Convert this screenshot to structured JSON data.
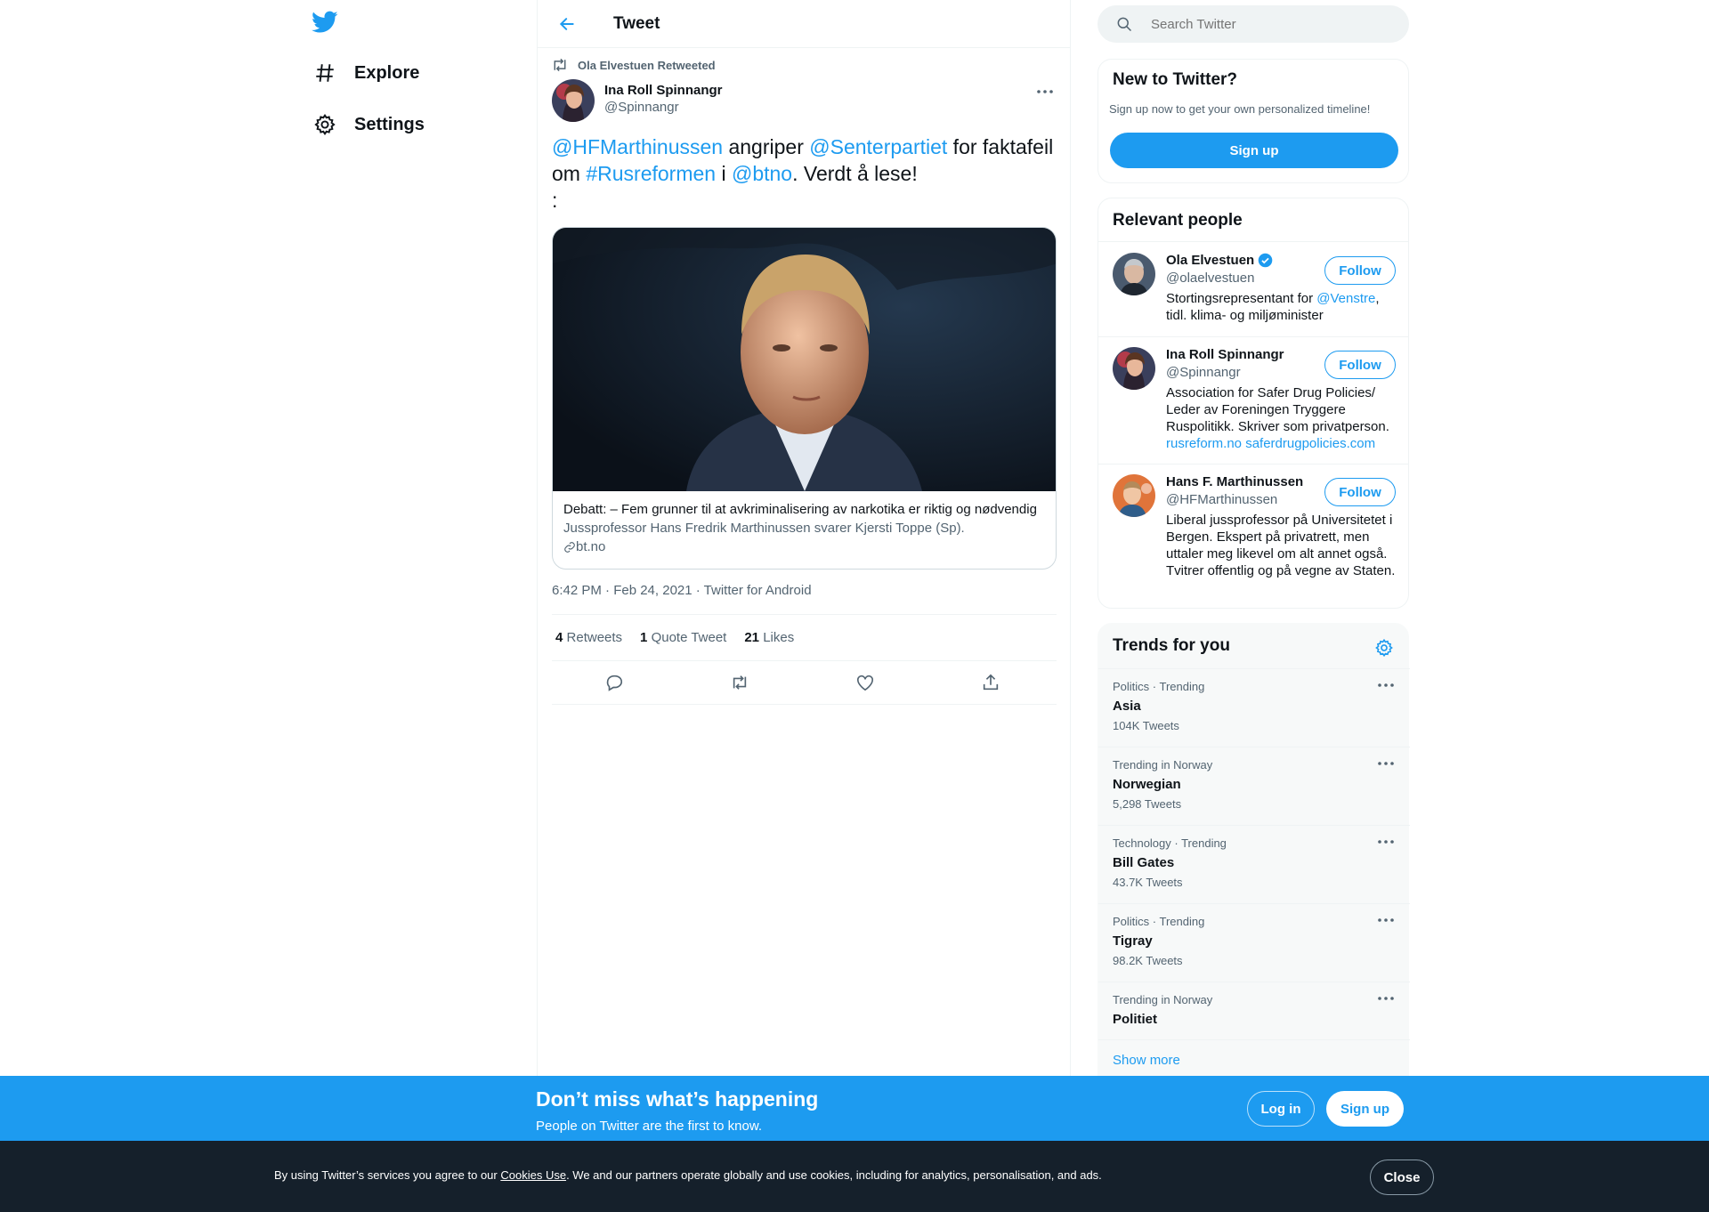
{
  "nav": {
    "logo": "twitter-bird-icon",
    "items": [
      {
        "label": "Explore",
        "icon": "hashtag-icon"
      },
      {
        "label": "Settings",
        "icon": "gear-icon"
      }
    ]
  },
  "header": {
    "title": "Tweet"
  },
  "tweet": {
    "retweeted_by": "Ola Elvestuen Retweeted",
    "author_name": "Ina Roll Spinnangr",
    "author_handle": "@Spinnangr",
    "text": {
      "m1": "@HFMarthinussen",
      "t1": " angriper ",
      "m2": "@Senterpartiet",
      "t2": " for faktafeil om ",
      "h1": "#Rusreformen",
      "t3": " i ",
      "m3": "@btno",
      "t4": ". Verdt å lese!",
      "t5": ":"
    },
    "card": {
      "title": "Debatt: – Fem grunner til at avkriminalisering av narkotika er riktig og nødvendig",
      "description": "Jussprofessor Hans Fredrik Marthinussen svarer Kjersti Toppe (Sp).",
      "domain": "bt.no"
    },
    "timestamp": "6:42 PM · Feb 24, 2021 · Twitter for Android",
    "stats": {
      "retweets": "4",
      "retweets_label": "Retweets",
      "quotes": "1",
      "quotes_label": "Quote Tweet",
      "likes": "21",
      "likes_label": "Likes"
    }
  },
  "search": {
    "placeholder": "Search Twitter"
  },
  "new_to_twitter": {
    "title": "New to Twitter?",
    "subtitle": "Sign up now to get your own personalized timeline!",
    "button": "Sign up"
  },
  "relevant_people": {
    "title": "Relevant people",
    "follow_label": "Follow",
    "people": [
      {
        "name": "Ola Elvestuen",
        "handle": "@olaelvestuen",
        "verified": true,
        "bio_a": "Stortingsrepresentant for ",
        "bio_link": "@Venstre",
        "bio_b": ", tidl. klima- og miljøminister"
      },
      {
        "name": "Ina Roll Spinnangr",
        "handle": "@Spinnangr",
        "bio_a": "Association for Safer Drug Policies/ Leder av Foreningen Tryggere Ruspolitikk. Skriver som privatperson.",
        "bio_link1": "rusreform.no",
        "bio_link2": "saferdrugpolicies.com"
      },
      {
        "name": "Hans F. Marthinussen",
        "handle": "@HFMarthinussen",
        "bio_a": "Liberal jussprofessor på Universitetet i Bergen. Ekspert på privatrett, men uttaler meg likevel om alt annet også. Tvitrer offentlig og på vegne av Staten."
      }
    ]
  },
  "trends": {
    "title": "Trends for you",
    "items": [
      {
        "context": "Politics · Trending",
        "name": "Asia",
        "count": "104K Tweets"
      },
      {
        "context": "Trending in Norway",
        "name": "Norwegian",
        "count": "5,298 Tweets"
      },
      {
        "context": "Technology · Trending",
        "name": "Bill Gates",
        "count": "43.7K Tweets"
      },
      {
        "context": "Politics · Trending",
        "name": "Tigray",
        "count": "98.2K Tweets"
      },
      {
        "context": "Trending in Norway",
        "name": "Politiet",
        "count": ""
      }
    ],
    "show_more": "Show more"
  },
  "banner": {
    "title": "Don’t miss what’s happening",
    "subtitle": "People on Twitter are the first to know.",
    "login": "Log in",
    "signup": "Sign up"
  },
  "cookie": {
    "text_a": "By using Twitter’s services you agree to our ",
    "link": "Cookies Use",
    "text_b": ". We and our partners operate globally and use cookies, including for analytics, personalisation, and ads.",
    "close": "Close"
  },
  "colors": {
    "accent": "#1d9bf0",
    "banner": "#1d9bf0",
    "cookie_bg": "#15202b"
  }
}
